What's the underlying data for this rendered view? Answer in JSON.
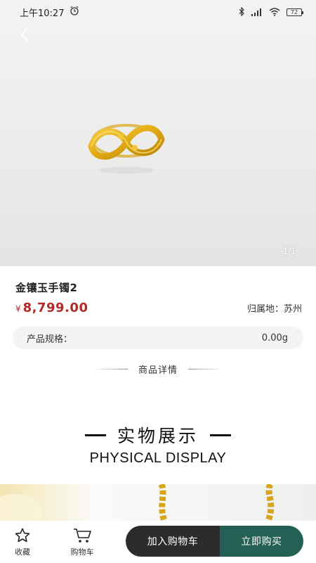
{
  "status_bar": {
    "time": "上午10:27",
    "battery": "72"
  },
  "gallery": {
    "counter": "1/1"
  },
  "product": {
    "title": "金镶玉手镯2",
    "currency_symbol": "¥",
    "price": "8,799.00",
    "origin": "归属地：苏州",
    "spec_label": "产品规格：",
    "spec_value": "0.00g"
  },
  "detail": {
    "section_title": "商品详情",
    "display_cn": "实物展示",
    "display_en": "PHYSICAL DISPLAY"
  },
  "bottom_bar": {
    "favorite_label": "收藏",
    "cart_label": "购物车",
    "add_to_cart": "加入购物车",
    "buy_now": "立即购买"
  },
  "colors": {
    "price": "#b22a2a",
    "add_to_cart_bg": "#2c2c2c",
    "buy_now_bg": "#246155"
  },
  "icons": {
    "alarm": "alarm-icon",
    "bluetooth": "bluetooth-icon",
    "signal": "signal-icon",
    "wifi": "wifi-icon",
    "back": "chevron-left-icon",
    "favorite": "star-icon",
    "cart": "cart-icon"
  }
}
